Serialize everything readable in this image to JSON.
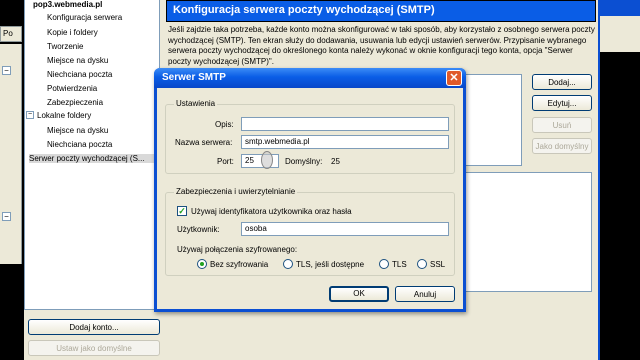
{
  "colors": {
    "title_bar": "#0a5de6",
    "dialog_bg": "#ece9d8",
    "window_frame": "#0b4fd2",
    "close_button": "#e05a2a"
  },
  "left_edge": {
    "tab_label": "Po"
  },
  "tree": {
    "account": "pop3.webmedia.pl",
    "items": [
      "Konfiguracja serwera",
      "Kopie i foldery",
      "Tworzenie",
      "Miejsce na dysku",
      "Niechciana poczta",
      "Potwierdzenia",
      "Zabezpieczenia"
    ],
    "local_folders": "Lokalne foldery",
    "local_items": [
      "Miejsce na dysku",
      "Niechciana poczta"
    ],
    "smtp_item": "Serwer poczty wychodzącej (S..."
  },
  "left_buttons": {
    "add_account": "Dodaj konto...",
    "set_default": "Ustaw jako domyślne"
  },
  "page": {
    "title": "Konfiguracja serwera poczty wychodzącej (SMTP)",
    "description": "Jeśli zajdzie taka potrzeba, każde konto można skonfigurować w taki sposób, aby korzystało z osobnego serwera poczty wychodzącej (SMTP). Ten ekran służy do dodawania, usuwania lub edycji ustawień serwerów. Przypisanie wybranego serwera poczty wychodzącej do określonego konta należy wykonać w oknie konfiguracji tego konta, opcja \"Serwer poczty wychodzącej (SMTP)\"."
  },
  "right_buttons": {
    "add": "Dodaj...",
    "edit": "Edytuj...",
    "remove": "Usuń",
    "set_default": "Jako domyślny"
  },
  "dialog": {
    "title": "Serwer SMTP",
    "settings_group": "Ustawienia",
    "description_label": "Opis:",
    "description_value": "",
    "server_label": "Nazwa serwera:",
    "server_value": "smtp.webmedia.pl",
    "port_label": "Port:",
    "port_value": "25",
    "default_label": "Domyślny:",
    "default_value": "25",
    "security_group": "Zabezpieczenia i uwierzytelnianie",
    "use_auth_label": "Używaj identyfikatora użytkownika oraz hasła",
    "use_auth_checked": true,
    "user_label": "Użytkownik:",
    "user_value": "osoba",
    "encryption_label": "Używaj połączenia szyfrowanego:",
    "encryption_options": [
      "Bez szyfrowania",
      "TLS, jeśli dostępne",
      "TLS",
      "SSL"
    ],
    "encryption_selected": 0,
    "ok": "OK",
    "cancel": "Anuluj"
  }
}
